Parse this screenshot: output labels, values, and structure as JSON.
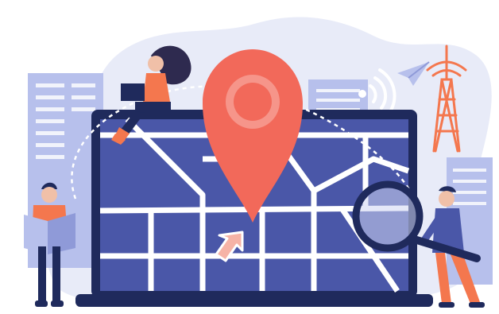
{
  "illustration": {
    "subject": "",
    "palette": {
      "background": "#ffffff",
      "blob": "#e8ebf8",
      "building": "#b7c0ec",
      "building_dark": "#8f9ad8",
      "laptop_frame": "#1f2a5c",
      "map_block": "#4a57a8",
      "map_road": "#ffffff",
      "pin": "#f2695a",
      "pin_light": "#f6958a",
      "accent_orange": "#f4774e",
      "skin": "#f0c0a8",
      "hair": "#2e2a4f",
      "navy": "#1f2a5c"
    },
    "icons": [
      "map-pin-icon",
      "cursor-arrow-icon",
      "magnifying-glass-icon",
      "wifi-signal-icon",
      "paper-plane-icon",
      "radio-tower-icon"
    ]
  }
}
